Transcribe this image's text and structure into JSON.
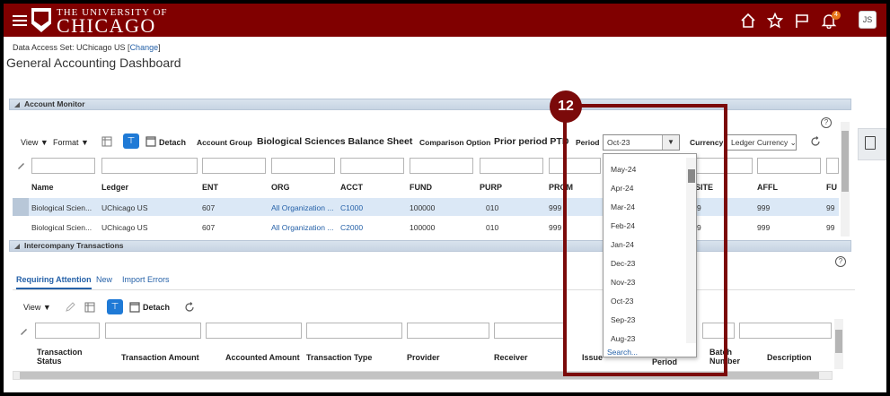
{
  "header": {
    "logo_top": "THE UNIVERSITY OF",
    "logo_main": "CHICAGO",
    "notification_count": "4",
    "user_initials": "JS"
  },
  "data_access": {
    "label": "Data Access Set: UChicago US [",
    "link": "Change",
    "suffix": "]"
  },
  "page_title": "General Accounting Dashboard",
  "account_monitor": {
    "title": "Account Monitor",
    "view": "View ▼",
    "format": "Format ▼",
    "detach": "Detach",
    "account_group_label": "Account Group",
    "account_group_value": "Biological Sciences Balance Sheet",
    "comparison_label": "Comparison Option",
    "comparison_value": "Prior period PTD",
    "period_label": "Period",
    "period_value": "Oct-23",
    "currency_label": "Currency",
    "currency_value": "Ledger Currency",
    "columns": [
      "Name",
      "Ledger",
      "ENT",
      "ORG",
      "ACCT",
      "FUND",
      "PURP",
      "PROM",
      "",
      "SITE",
      "AFFL",
      "FU"
    ],
    "rows": [
      [
        "Biological Scien...",
        "UChicago US",
        "607",
        "All Organization ...",
        "C1000",
        "100000",
        "010",
        "999",
        "",
        "9",
        "999",
        "99"
      ],
      [
        "Biological Scien...",
        "UChicago US",
        "607",
        "All Organization ...",
        "C2000",
        "100000",
        "010",
        "999",
        "",
        "9",
        "999",
        "99"
      ]
    ]
  },
  "period_dropdown": {
    "options": [
      "May-24",
      "Apr-24",
      "Mar-24",
      "Feb-24",
      "Jan-24",
      "Dec-23",
      "Nov-23",
      "Oct-23",
      "Sep-23",
      "Aug-23"
    ],
    "search_label": "Search..."
  },
  "callout": {
    "step": "12"
  },
  "intercompany": {
    "title": "Intercompany Transactions",
    "tabs": [
      "Requiring Attention",
      "New",
      "Import Errors"
    ],
    "view": "View ▼",
    "detach": "Detach",
    "columns": [
      "Transaction Status",
      "Transaction Amount",
      "Accounted Amount",
      "Transaction Type",
      "Provider",
      "Receiver",
      "Issue",
      "Period",
      "Batch Number",
      "Description"
    ]
  }
}
